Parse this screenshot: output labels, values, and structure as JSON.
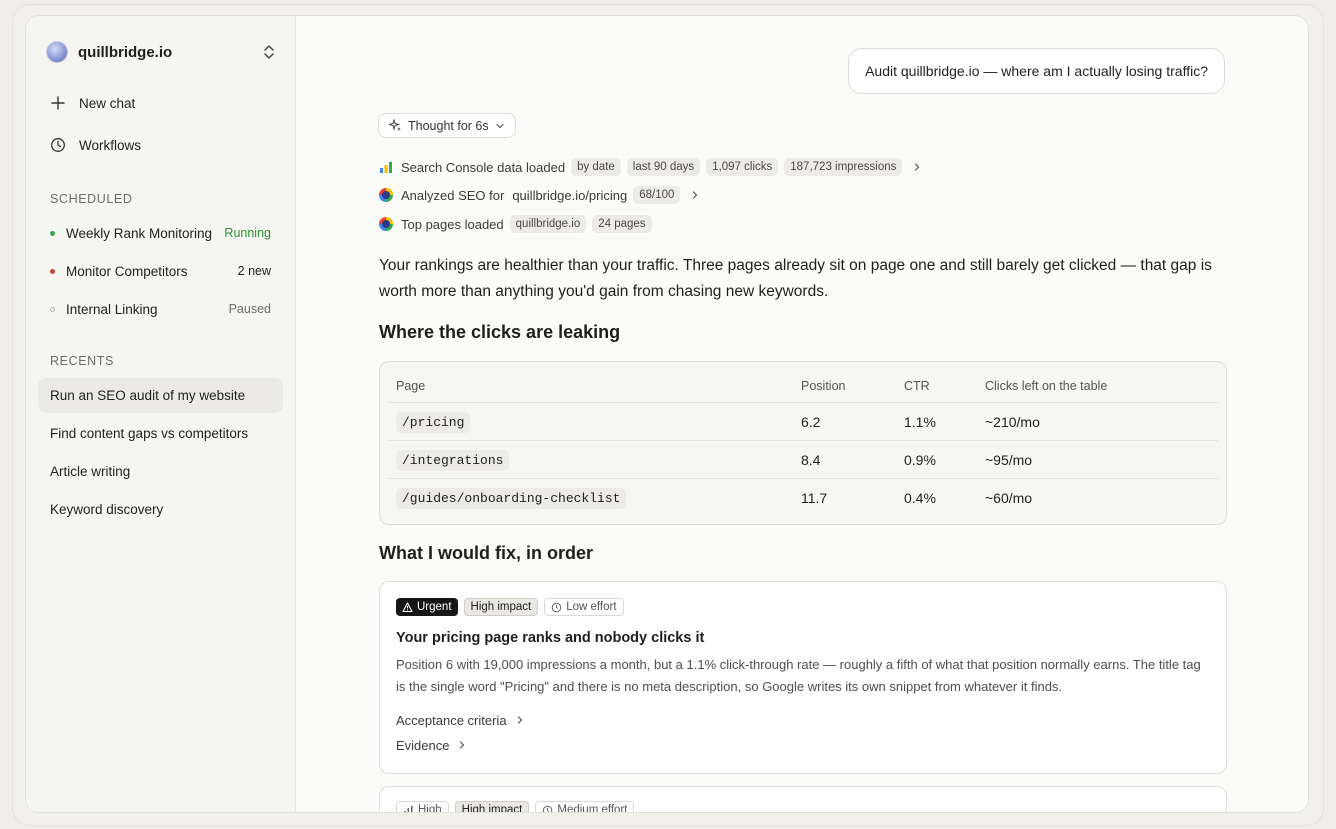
{
  "sidebar": {
    "workspace": "quillbridge.io",
    "nav": [
      {
        "label": "New chat",
        "icon": "plus-icon"
      },
      {
        "label": "Workflows",
        "icon": "clock-icon"
      }
    ],
    "scheduled_heading": "SCHEDULED",
    "scheduled": [
      {
        "name": "Weekly Rank Monitoring",
        "status": "Running",
        "status_color": "#2f8f3a",
        "dot_color": "#3aa64a"
      },
      {
        "name": "Monitor Competitors",
        "status": "2 new",
        "status_color": "#1f1f1d",
        "dot_color": "#c0483b"
      },
      {
        "name": "Internal Linking",
        "status": "Paused",
        "status_color": "#6d6c68",
        "dot_color": "#ffffff"
      }
    ],
    "recents_heading": "RECENTS",
    "recents": [
      "Run an SEO audit of my website",
      "Find content gaps vs competitors",
      "Article writing",
      "Keyword discovery"
    ]
  },
  "chat": {
    "user_message": "Audit quillbridge.io — where am I actually losing traffic?",
    "thought": "Thought for 6s",
    "tools": {
      "gsc": {
        "label": "Search Console data loaded",
        "chips": [
          "by date",
          "last 90 days",
          "1,097 clicks",
          "187,723 impressions"
        ]
      },
      "seo": {
        "label": "Analyzed SEO for",
        "target": "quillbridge.io/pricing",
        "chip": "68/100"
      },
      "top": {
        "label": "Top pages loaded",
        "chips": [
          "quillbridge.io",
          "24 pages"
        ]
      }
    },
    "intro": "Your rankings are healthier than your traffic. Three pages already sit on page one and still barely get clicked — that gap is worth more than anything you'd gain from chasing new keywords.",
    "table_heading": "Where the clicks are leaking",
    "table": {
      "headers": [
        "Page",
        "Position",
        "CTR",
        "Clicks left on the table"
      ],
      "rows": [
        [
          "/pricing",
          "6.2",
          "1.1%",
          "~210/mo"
        ],
        [
          "/integrations",
          "8.4",
          "0.9%",
          "~95/mo"
        ],
        [
          "/guides/onboarding-checklist",
          "11.7",
          "0.4%",
          "~60/mo"
        ]
      ]
    },
    "fix_heading": "What I would fix, in order",
    "fix1": {
      "badges": [
        "Urgent",
        "High impact",
        "Low effort"
      ],
      "title": "Your pricing page ranks and nobody clicks it",
      "body": "Position 6 with 19,000 impressions a month, but a 1.1% click-through rate — roughly a fifth of what that position normally earns. The title tag is the single word \"Pricing\" and there is no meta description, so Google writes its own snippet from whatever it finds.",
      "acceptance": "Acceptance criteria",
      "evidence": "Evidence"
    },
    "fix2": {
      "badges": [
        "High",
        "High impact",
        "Medium effort"
      ]
    }
  }
}
